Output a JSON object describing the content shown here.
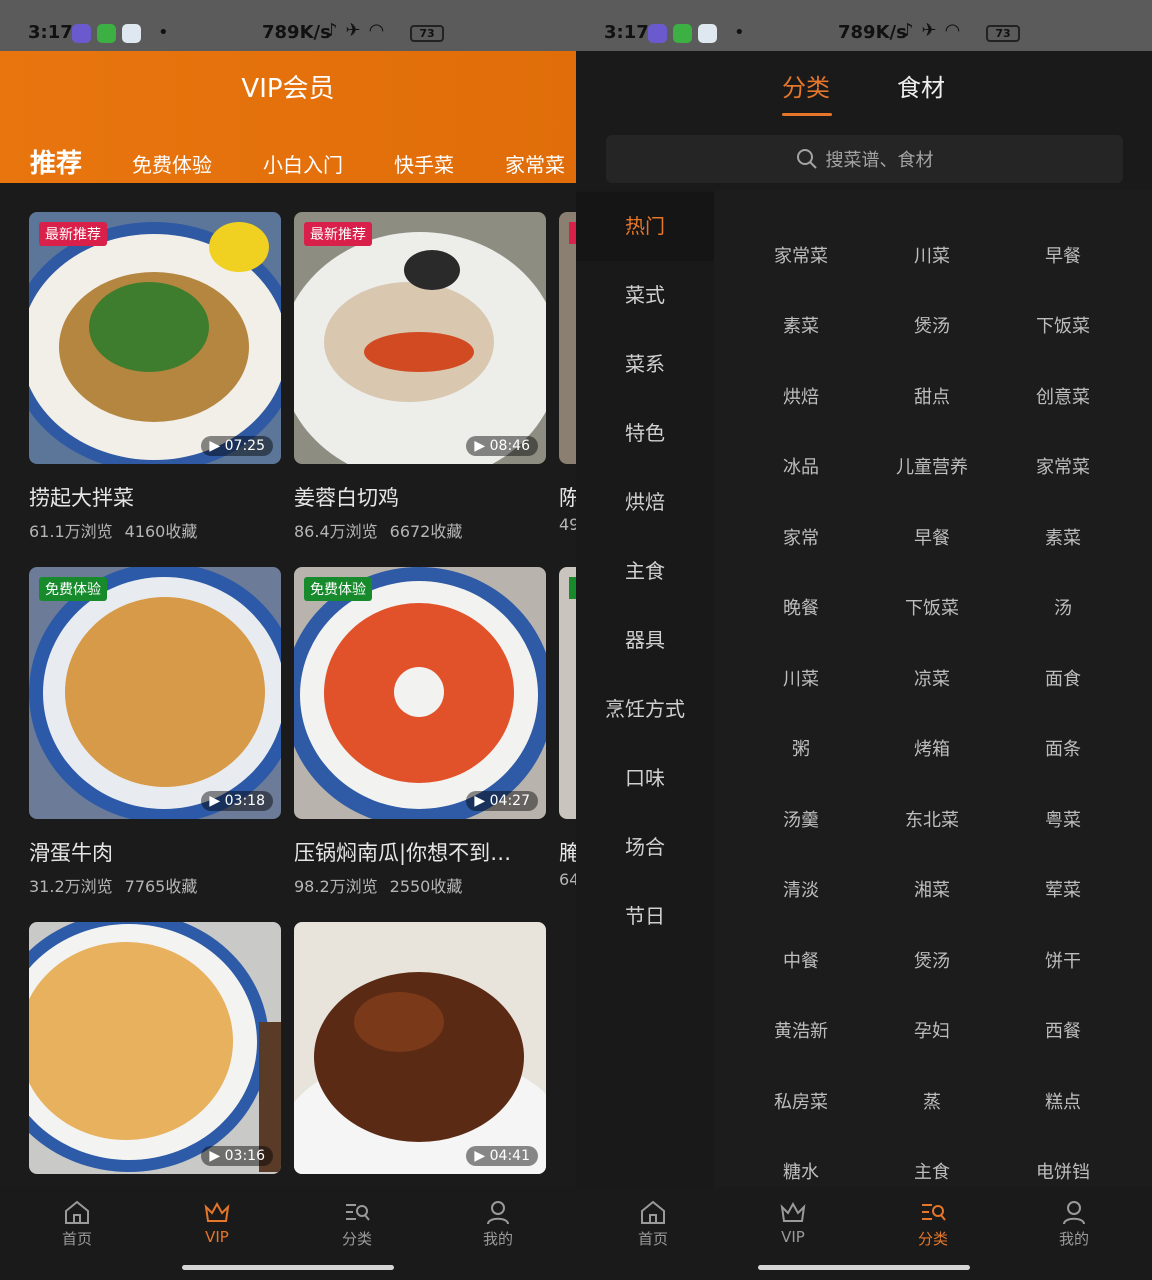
{
  "status_bar": {
    "time": "3:17",
    "network_speed": "789K/s",
    "battery": "73",
    "dot": "•"
  },
  "left": {
    "header_title": "VIP会员",
    "tabs": [
      "推荐",
      "免费体验",
      "小白入门",
      "快手菜",
      "家常菜"
    ],
    "cards": [
      {
        "badge": "最新推荐",
        "badge_color": "#d8204a",
        "duration": "07:25",
        "title": "捞起大拌菜",
        "views": "61.1万浏览",
        "favorites": "4160收藏"
      },
      {
        "badge": "最新推荐",
        "badge_color": "#d8204a",
        "duration": "08:46",
        "title": "姜蓉白切鸡",
        "views": "86.4万浏览",
        "favorites": "6672收藏"
      },
      {
        "badge": "免费体验",
        "badge_color": "#178a2c",
        "duration": "03:18",
        "title": "滑蛋牛肉",
        "views": "31.2万浏览",
        "favorites": "7765收藏"
      },
      {
        "badge": "免费体验",
        "badge_color": "#178a2c",
        "duration": "04:27",
        "title": "压锅焖南瓜|你想不到…",
        "views": "98.2万浏览",
        "favorites": "2550收藏"
      },
      {
        "duration": "03:16"
      },
      {
        "duration": "04:41"
      }
    ],
    "partial_cards": {
      "title_1": "陈",
      "stat_1": "49",
      "title_2": "腌",
      "stat_2": "64"
    },
    "nav": [
      "首页",
      "VIP",
      "分类",
      "我的"
    ],
    "active_nav": "VIP"
  },
  "right": {
    "tabs": [
      "分类",
      "食材"
    ],
    "search_placeholder": "搜菜谱、食材",
    "sidebar": [
      "热门",
      "菜式",
      "菜系",
      "特色",
      "烘焙",
      "主食",
      "器具",
      "烹饪方式",
      "口味",
      "场合",
      "节日"
    ],
    "grid": [
      "家常菜",
      "川菜",
      "早餐",
      "素菜",
      "煲汤",
      "下饭菜",
      "烘焙",
      "甜点",
      "创意菜",
      "冰品",
      "儿童营养",
      "家常菜",
      "家常",
      "早餐",
      "素菜",
      "晚餐",
      "下饭菜",
      "汤",
      "川菜",
      "凉菜",
      "面食",
      "粥",
      "烤箱",
      "面条",
      "汤羹",
      "东北菜",
      "粤菜",
      "清淡",
      "湘菜",
      "荤菜",
      "中餐",
      "煲汤",
      "饼干",
      "黄浩新",
      "孕妇",
      "西餐",
      "私房菜",
      "蒸",
      "糕点",
      "糖水",
      "主食",
      "电饼铛"
    ],
    "nav": [
      "首页",
      "VIP",
      "分类",
      "我的"
    ],
    "active_nav": "分类"
  },
  "colors": {
    "accent": "#e5762a",
    "header_orange": "#e8750e"
  }
}
